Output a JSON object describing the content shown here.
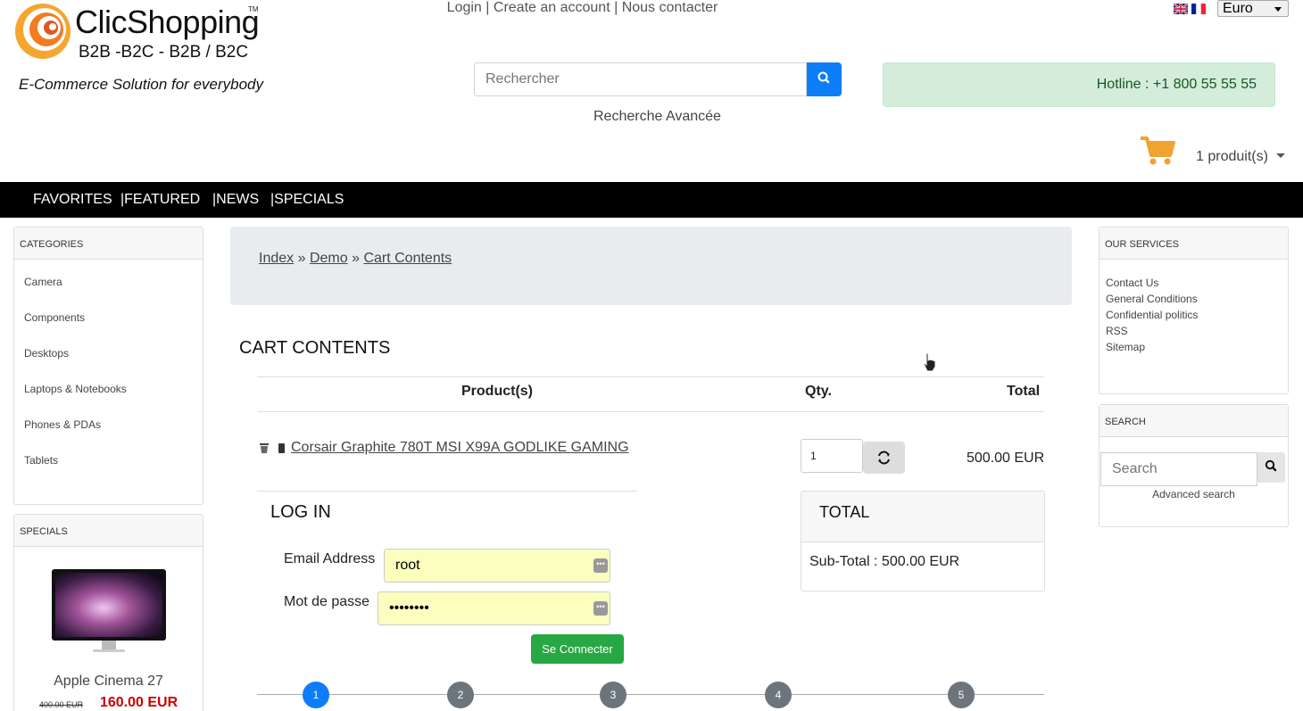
{
  "header": {
    "logo_name": "ClicShopping",
    "logo_tm": "TM",
    "logo_tagline": "B2B -B2C - B2B / B2C",
    "logo_slogan": "E-Commerce Solution for everybody",
    "links": [
      "Login",
      "Create an account",
      "Nous contacter"
    ],
    "currency": "Euro",
    "search_placeholder": "Rechercher",
    "advanced_search": "Recherche Avancée",
    "hotline": "Hotline : +1 800 55 55 55",
    "cart_count": "1 produit(s)"
  },
  "nav": {
    "items": [
      "FAVORITES",
      "|FEATURED",
      "|NEWS",
      "|SPECIALS"
    ]
  },
  "categories": {
    "title": "CATEGORIES",
    "items": [
      "Camera",
      "Components",
      "Desktops",
      "Laptops & Notebooks",
      "Phones & PDAs",
      "Tablets"
    ]
  },
  "specials": {
    "title": "SPECIALS",
    "product_name": "Apple Cinema 27",
    "old_price": "400.00 EUR",
    "new_price": "160.00 EUR"
  },
  "services": {
    "title": "OUR SERVICES",
    "items": [
      "Contact Us",
      "General Conditions",
      "Confidential politics",
      "RSS",
      "Sitemap"
    ]
  },
  "side_search": {
    "title": "SEARCH",
    "placeholder": "Search",
    "advanced": "Advanced search"
  },
  "breadcrumb": {
    "items": [
      "Index",
      "Demo",
      "Cart Contents"
    ],
    "separator": "»"
  },
  "cart": {
    "title": "CART CONTENTS",
    "col_product": "Product(s)",
    "col_qty": "Qty.",
    "col_total": "Total",
    "product_name": "Corsair Graphite 780T MSI X99A GODLIKE GAMING",
    "qty": "1",
    "row_total": "500.00 EUR"
  },
  "login": {
    "title": "LOG IN",
    "email_label": "Email Address",
    "email_value": "root",
    "password_label": "Mot de passe",
    "password_value": "••••••••",
    "button": "Se Connecter"
  },
  "totals": {
    "title": "TOTAL",
    "subtotal": "Sub-Total :  500.00 EUR"
  },
  "steps": [
    "1",
    "2",
    "3",
    "4",
    "5"
  ]
}
